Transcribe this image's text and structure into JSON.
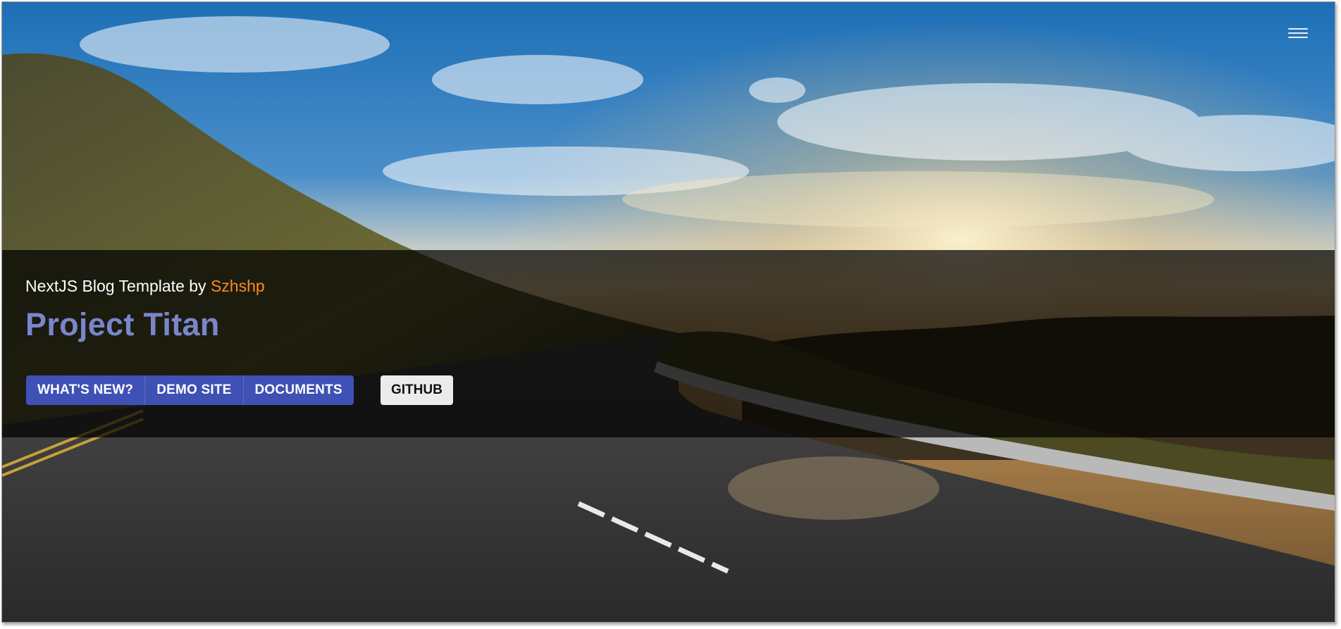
{
  "header": {
    "menu_icon": "hamburger-menu-icon"
  },
  "hero": {
    "subtitle_prefix": "NextJS Blog Template by",
    "author": "Szhshp",
    "title": "Project Titan",
    "buttons": [
      "WHAT'S NEW?",
      "DEMO SITE",
      "DOCUMENTS"
    ],
    "github_button": "GITHUB"
  },
  "colors": {
    "primary": "#3f51b5",
    "title": "#7986cb",
    "author_link": "#ff8a1e",
    "secondary_button": "#ebebeb"
  }
}
